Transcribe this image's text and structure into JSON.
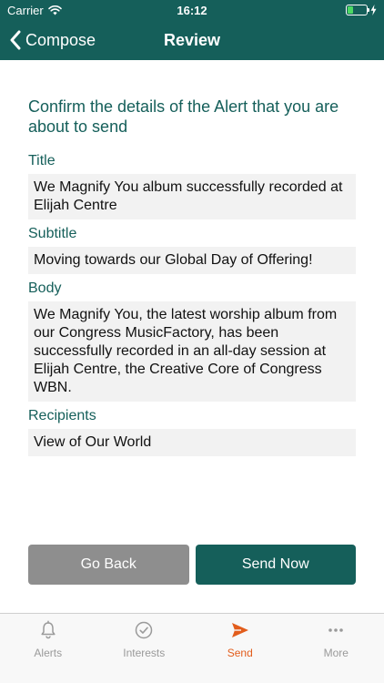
{
  "status_bar": {
    "carrier": "Carrier",
    "time": "16:12",
    "battery_level": 0.3
  },
  "nav": {
    "back_label": "Compose",
    "title": "Review"
  },
  "intro_text": "Confirm the details of the Alert that you are about to send",
  "fields": {
    "title": {
      "label": "Title",
      "value": "We Magnify You album successfully recorded at Elijah Centre"
    },
    "subtitle": {
      "label": "Subtitle",
      "value": "Moving towards our Global Day of Offering!"
    },
    "body": {
      "label": "Body",
      "value": "We Magnify You, the latest worship album from our Congress MusicFactory, has been successfully recorded in an all-day session at Elijah Centre, the Creative Core of Congress WBN."
    },
    "recipients": {
      "label": "Recipients",
      "value": "View of Our World"
    }
  },
  "buttons": {
    "go_back": "Go Back",
    "send_now": "Send Now"
  },
  "tabs": [
    {
      "label": "Alerts",
      "icon": "bell-icon",
      "active": false
    },
    {
      "label": "Interests",
      "icon": "checkmark-circle-icon",
      "active": false
    },
    {
      "label": "Send",
      "icon": "paper-plane-icon",
      "active": true
    },
    {
      "label": "More",
      "icon": "ellipsis-icon",
      "active": false
    }
  ],
  "colors": {
    "brand": "#155f5a",
    "accent": "#e25d1c",
    "secondary_button": "#8e8e8e",
    "field_background": "#f2f2f2",
    "battery_fill": "#4cd964"
  }
}
